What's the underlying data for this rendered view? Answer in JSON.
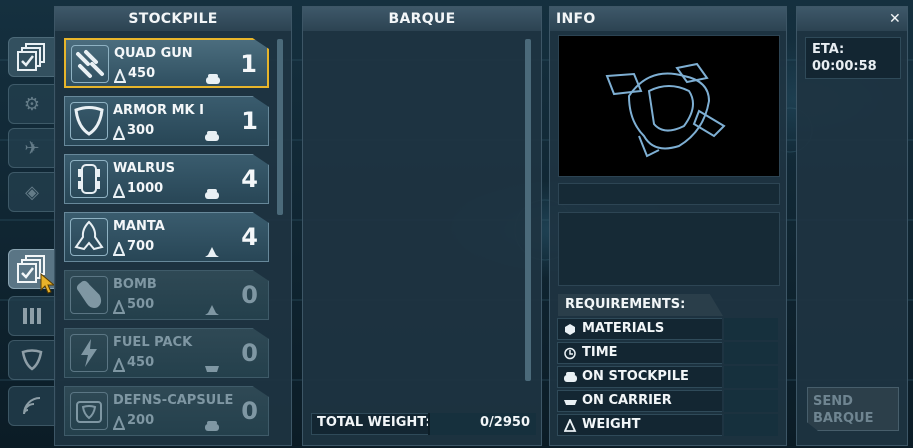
{
  "panels": {
    "stockpile_title": "STOCKPILE",
    "barque_title": "BARQUE",
    "info_title": "INFO"
  },
  "stockpile": {
    "items": [
      {
        "name": "QUAD GUN",
        "weight": "450",
        "count": "1",
        "state": "selected",
        "icon": "quad-gun-icon",
        "type_icon": "stockpile-icon"
      },
      {
        "name": "ARMOR MK I",
        "weight": "300",
        "count": "1",
        "state": "normal",
        "icon": "armor-icon",
        "type_icon": "stockpile-icon"
      },
      {
        "name": "WALRUS",
        "weight": "1000",
        "count": "4",
        "state": "normal",
        "icon": "walrus-icon",
        "type_icon": "stockpile-icon"
      },
      {
        "name": "MANTA",
        "weight": "700",
        "count": "4",
        "state": "normal",
        "icon": "manta-icon",
        "type_icon": "aircraft-icon"
      },
      {
        "name": "BOMB",
        "weight": "500",
        "count": "0",
        "state": "disabled",
        "icon": "bomb-icon",
        "type_icon": "aircraft-icon"
      },
      {
        "name": "FUEL PACK",
        "weight": "450",
        "count": "0",
        "state": "disabled",
        "icon": "fuel-icon",
        "type_icon": "carrier-icon"
      },
      {
        "name": "DEFNS-CAPSULE",
        "weight": "200",
        "count": "0",
        "state": "disabled",
        "icon": "defense-capsule-icon",
        "type_icon": "stockpile-icon"
      }
    ]
  },
  "barque": {
    "total_weight_label": "TOTAL WEIGHT:",
    "total_weight_value": "0/2950"
  },
  "info": {
    "requirements_title": "REQUIREMENTS:",
    "rows": [
      {
        "label": "MATERIALS",
        "icon": "cube-icon"
      },
      {
        "label": "TIME",
        "icon": "clock-icon"
      },
      {
        "label": "ON STOCKPILE",
        "icon": "stockpile-icon"
      },
      {
        "label": "ON CARRIER",
        "icon": "carrier-icon"
      },
      {
        "label": "WEIGHT",
        "icon": "weight-icon"
      }
    ]
  },
  "eta": {
    "label": "ETA:",
    "value": "00:00:58",
    "send_button": "SEND BARQUE",
    "close": "✕"
  },
  "colors": {
    "selected_border": "#e7b52b",
    "panel_bg": "#1e3442",
    "header_bg": "#3e5869"
  }
}
